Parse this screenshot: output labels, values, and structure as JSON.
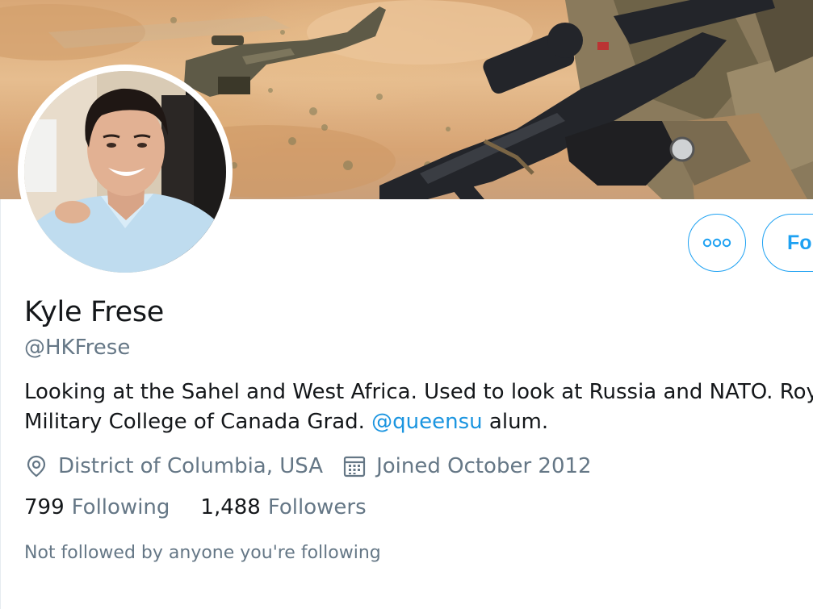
{
  "profile": {
    "name": "Kyle Frese",
    "handle": "@HKFrese",
    "bio_line1": "Looking at the Sahel and West Africa. Used to look at Russia and NATO. Royal",
    "bio_line2_prefix": "Military College of Canada Grad. ",
    "bio_mention": "@queensu",
    "bio_line2_suffix": " alum.",
    "location": "District of Columbia, USA",
    "joined": "Joined October 2012",
    "following_count": "799",
    "following_label": "Following",
    "followers_count": "1,488",
    "followers_label": "Followers",
    "not_followed_text": "Not followed by anyone you're following"
  },
  "actions": {
    "more_icon": "more-dots-icon",
    "follow_label": "Follow"
  },
  "icons": {
    "location": "location-pin-icon",
    "calendar": "calendar-icon"
  },
  "colors": {
    "accent": "#1da1f2",
    "link": "#1b95e0",
    "text_primary": "#14171a",
    "text_secondary": "#657786"
  }
}
